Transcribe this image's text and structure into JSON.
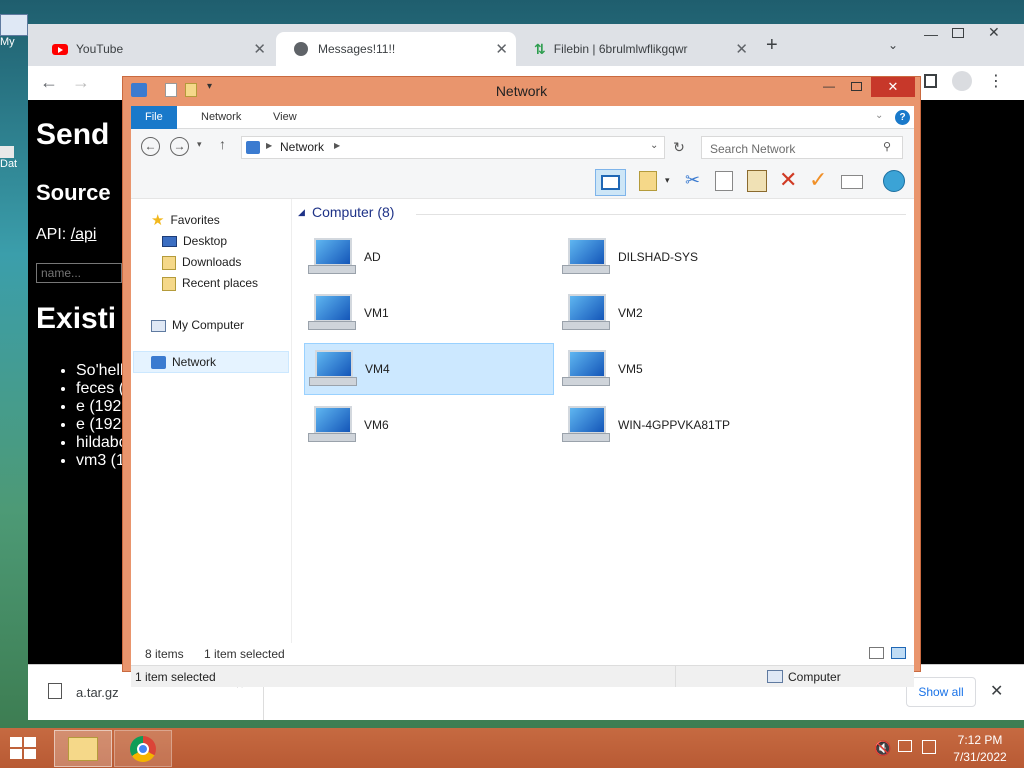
{
  "desktop": {
    "icons": [
      "My",
      "Dat"
    ]
  },
  "browser": {
    "tabs": [
      {
        "label": "YouTube",
        "icon": "youtube-icon"
      },
      {
        "label": "Messages!11!!",
        "icon": "globe-icon"
      },
      {
        "label": "Filebin | 6brulmlwflikgqwr",
        "icon": "filebin-icon"
      }
    ],
    "new_tab": "+",
    "page": {
      "heading1": "Send",
      "heading2": "Source",
      "api_label": "API: ",
      "api_link": "/api",
      "name_placeholder": "name...",
      "heading3": "Existi",
      "list": [
        "So'hell",
        "feces (",
        "e (192",
        "e (192",
        "hildabo",
        "vm3 (1"
      ]
    },
    "downloads": {
      "file": "a.tar.gz",
      "show_all": "Show all"
    }
  },
  "explorer": {
    "title": "Network",
    "ribbon_tabs": [
      "File",
      "Network",
      "View"
    ],
    "address": "Network",
    "search_placeholder": "Search Network",
    "nav": {
      "favorites": "Favorites",
      "desktop": "Desktop",
      "downloads": "Downloads",
      "recent": "Recent places",
      "my_computer": "My Computer",
      "network": "Network"
    },
    "group_header": "Computer (8)",
    "computers": [
      {
        "name": "AD",
        "selected": false
      },
      {
        "name": "DILSHAD-SYS",
        "selected": false
      },
      {
        "name": "VM1",
        "selected": false
      },
      {
        "name": "VM2",
        "selected": false
      },
      {
        "name": "VM4",
        "selected": true
      },
      {
        "name": "VM5",
        "selected": false
      },
      {
        "name": "VM6",
        "selected": false
      },
      {
        "name": "WIN-4GPPVKA81TP",
        "selected": false
      }
    ],
    "status": {
      "count": "8 items",
      "selected": "1 item selected",
      "bottom_left": "1 item selected",
      "bottom_right": "Computer"
    }
  },
  "taskbar": {
    "time": "7:12 PM",
    "date": "7/31/2022"
  }
}
